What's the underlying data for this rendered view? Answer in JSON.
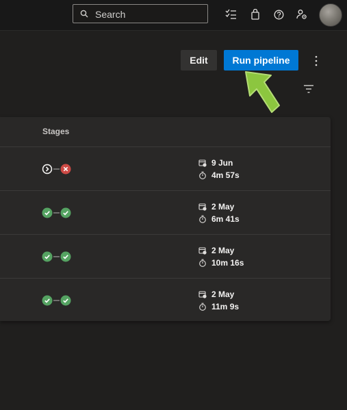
{
  "topbar": {
    "search": {
      "placeholder": "Search"
    },
    "icons": [
      "work-items-icon",
      "marketplace-bag-icon",
      "help-icon",
      "user-settings-icon"
    ]
  },
  "actions": {
    "edit_label": "Edit",
    "run_label": "Run pipeline"
  },
  "table": {
    "columns": {
      "stages": "Stages"
    },
    "rows": [
      {
        "stages": [
          "running",
          "failed"
        ],
        "date": "9 Jun",
        "duration": "4m 57s"
      },
      {
        "stages": [
          "succeeded",
          "succeeded"
        ],
        "date": "2 May",
        "duration": "6m 41s"
      },
      {
        "stages": [
          "succeeded",
          "succeeded"
        ],
        "date": "2 May",
        "duration": "10m 16s"
      },
      {
        "stages": [
          "succeeded",
          "succeeded"
        ],
        "date": "2 May",
        "duration": "11m 9s"
      }
    ]
  },
  "colors": {
    "accent": "#0078d4",
    "success": "#55a362",
    "failure": "#cd4a45",
    "highlight_arrow": "#8cc63f"
  }
}
